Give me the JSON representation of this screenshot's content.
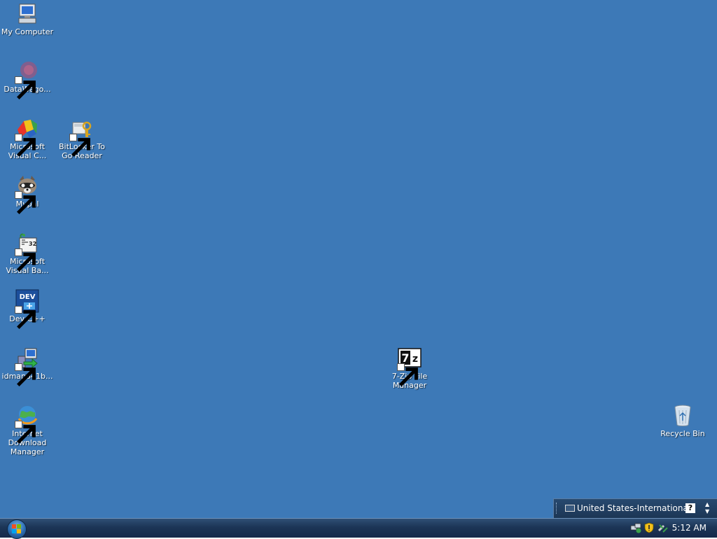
{
  "desktop": {
    "background": "#3d79b7",
    "icons": [
      {
        "label": "My Computer",
        "icon": "computer-icon"
      },
      {
        "label": "DataWago...",
        "icon": "datawagon-icon"
      },
      {
        "label": "Microsoft\nVisual C...",
        "icon": "visual-cpp-icon"
      },
      {
        "label": "BitLocker To\nGo Reader",
        "icon": "bitlocker-icon"
      },
      {
        "label": "Mypal",
        "icon": "mypal-raccoon-icon"
      },
      {
        "label": "Microsoft\nVisual Ba...",
        "icon": "visual-basic-icon"
      },
      {
        "label": "Dev-C++",
        "icon": "dev-cpp-icon"
      },
      {
        "label": "idman641b...",
        "icon": "installer-icon"
      },
      {
        "label": "Internet\nDownload\nManager",
        "icon": "internet-download-manager-icon"
      },
      {
        "label": "7-Zip File\nManager",
        "icon": "7zip-icon"
      },
      {
        "label": "Recycle Bin",
        "icon": "recycle-bin-icon"
      }
    ]
  },
  "language_bar": {
    "language": "United States-International",
    "help_label": "?"
  },
  "taskbar": {
    "clock": "5:12 AM",
    "tray_icons": [
      "network-icon",
      "security-shield-icon",
      "safely-remove-hardware-icon"
    ]
  }
}
